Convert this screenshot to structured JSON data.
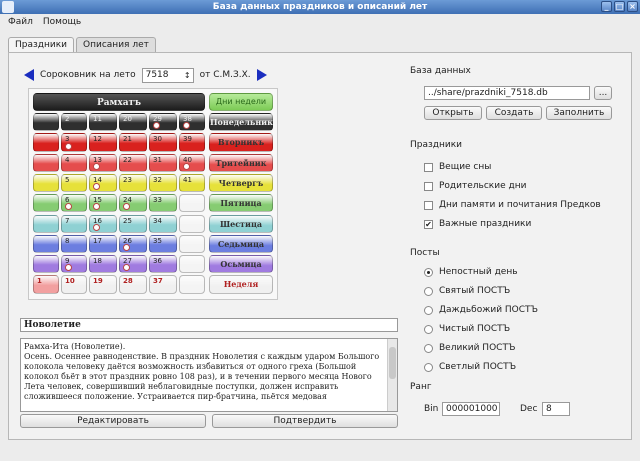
{
  "window": {
    "title": "База данных праздников и описаний лет"
  },
  "menu": [
    "Файл",
    "Помощь"
  ],
  "tabs": [
    "Праздники",
    "Описания лет"
  ],
  "calendar": {
    "header_prefix": "Сороковник на лето",
    "year": "7518",
    "header_suffix": "от С.М.З.Х.",
    "month_name": "Рамхатъ",
    "days_header": "Дни недели",
    "weekdays": [
      "Понедельник",
      "Вторникъ",
      "Тритейник",
      "Четвергъ",
      "Пятница",
      "Шестица",
      "Седьмица",
      "Осьмица",
      "Неделя"
    ],
    "rows": [
      [
        "",
        "2",
        "11",
        "20",
        "29",
        "38"
      ],
      [
        "",
        "3",
        "12",
        "21",
        "30",
        "39"
      ],
      [
        "",
        "4",
        "13",
        "22",
        "31",
        "40"
      ],
      [
        "",
        "5",
        "14",
        "23",
        "32",
        "41"
      ],
      [
        "",
        "6",
        "15",
        "24",
        "33",
        ""
      ],
      [
        "",
        "7",
        "16",
        "25",
        "34",
        ""
      ],
      [
        "",
        "8",
        "17",
        "26",
        "35",
        ""
      ],
      [
        "",
        "9",
        "18",
        "27",
        "36",
        ""
      ],
      [
        "1",
        "10",
        "19",
        "28",
        "37",
        ""
      ]
    ],
    "row_colors": [
      "#2f2f2f",
      "#d9211e",
      "#e54d4d",
      "#e6e13a",
      "#86cc72",
      "#8fd1d3",
      "#6c7ee0",
      "#a07be0",
      "#f0f0f0"
    ]
  },
  "holiday": {
    "name": "Новолетие",
    "description": "Рамха-Ита (Новолетие).\nОсень. Осеннее равноденствие. В праздник Новолетия с каждым ударом Большого колокола человеку даётся возможность избавиться от одного греха (Большой колокол бьёт в этот праздник ровно 108 раз), и в течении первого месяца Нового Лета человек, совершивший неблаговидные поступки, должен исправить сложившееся положение. Устраивается пир-братчина, пьётся медовая"
  },
  "buttons": {
    "edit": "Редактировать",
    "confirm": "Подтвердить",
    "open": "Открыть",
    "create": "Создать",
    "fill": "Заполнить",
    "browse": "..."
  },
  "database": {
    "label": "База данных",
    "path": "../share/prazdniki_7518.db"
  },
  "holidays_section": {
    "label": "Праздники",
    "items": [
      {
        "label": "Вещие сны",
        "checked": false
      },
      {
        "label": "Родительские дни",
        "checked": false
      },
      {
        "label": "Дни памяти и почитания Предков",
        "checked": false
      },
      {
        "label": "Важные праздники",
        "checked": true
      }
    ]
  },
  "posts_section": {
    "label": "Посты",
    "items": [
      {
        "label": "Непостный день",
        "checked": true
      },
      {
        "label": "Святый ПОСТЪ",
        "checked": false
      },
      {
        "label": "Даждьбожий ПОСТЪ",
        "checked": false
      },
      {
        "label": "Чистый ПОСТЪ",
        "checked": false
      },
      {
        "label": "Великий ПОСТЪ",
        "checked": false
      },
      {
        "label": "Светлый ПОСТЪ",
        "checked": false
      }
    ]
  },
  "rank": {
    "label": "Ранг",
    "bin_label": "Bin",
    "bin_value": "000001000",
    "dec_label": "Dec",
    "dec_value": "8"
  }
}
